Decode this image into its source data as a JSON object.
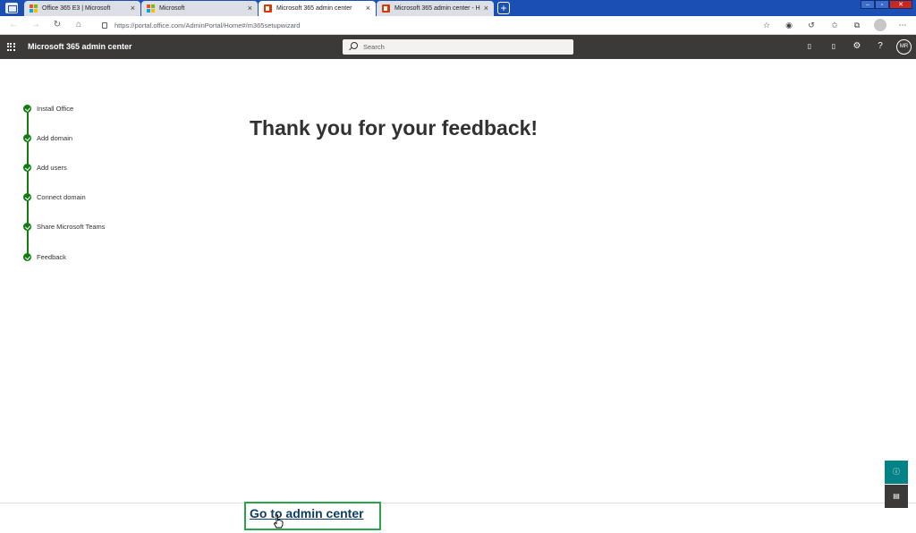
{
  "browser": {
    "tabs": [
      {
        "label": "Office 365 E3 | Microsoft",
        "favicon": "microsoft-logo-icon",
        "active": false
      },
      {
        "label": "Microsoft",
        "favicon": "microsoft-logo-icon",
        "active": false
      },
      {
        "label": "Microsoft 365 admin center",
        "favicon": "office-logo-icon",
        "active": true
      },
      {
        "label": "Microsoft 365 admin center - H",
        "favicon": "office-logo-icon",
        "active": false
      }
    ],
    "close_glyph": "×",
    "new_tab_glyph": "+",
    "url": "https://portal.office.com/AdminPortal/Home#/m365setupwizard"
  },
  "header": {
    "app_title": "Microsoft 365 admin center",
    "search_placeholder": "Search",
    "avatar_initials": "MR",
    "help_glyph": "?"
  },
  "wizard": {
    "steps": [
      {
        "label": "Install Office",
        "status": "complete"
      },
      {
        "label": "Add domain",
        "status": "complete"
      },
      {
        "label": "Add users",
        "status": "complete"
      },
      {
        "label": "Connect domain",
        "status": "complete"
      },
      {
        "label": "Share Microsoft Teams",
        "status": "complete"
      },
      {
        "label": "Feedback",
        "status": "complete"
      }
    ]
  },
  "main": {
    "heading": "Thank you for your feedback!",
    "cta_link": "Go to admin center"
  },
  "colors": {
    "browser_frame": "#1c4fb4",
    "m365_header": "#3b3a39",
    "step_complete": "#107c10",
    "link": "#0f3d66",
    "highlight_box": "#2aa34a",
    "help_button": "#038387"
  }
}
